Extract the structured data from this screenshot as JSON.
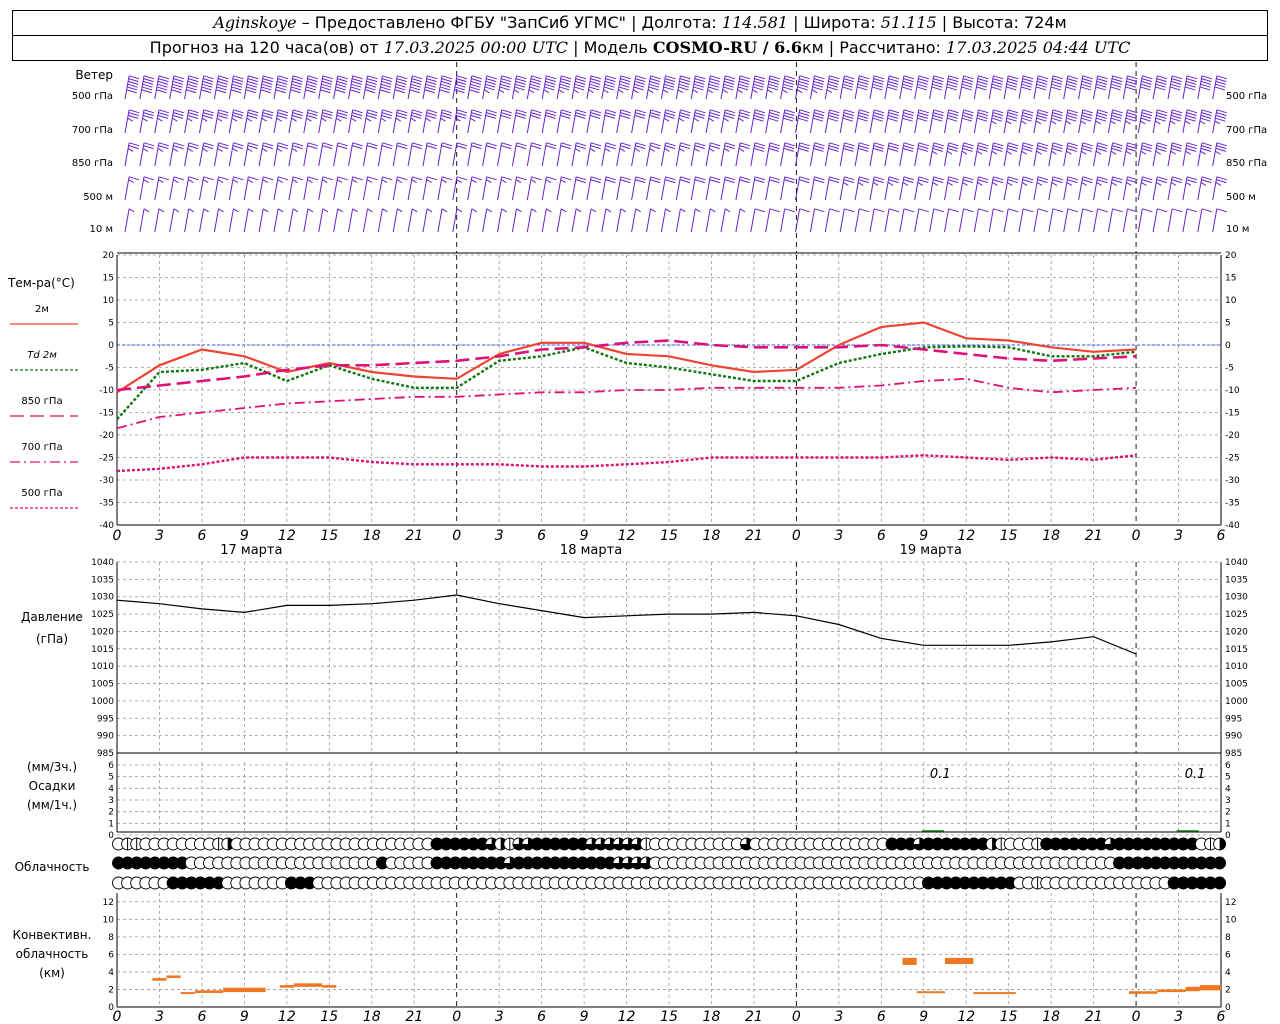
{
  "header": {
    "station": "Aginskoye",
    "provider": " – Предоставлено ФГБУ \"ЗапСиб УГМС\" | Долгота: ",
    "lon": "114.581",
    "lat_label": " | Широта: ",
    "lat": "51.115",
    "alt_label": " | Высота: ",
    "alt": "724м",
    "forecast_label": "Прогноз на 120 часа(ов) от ",
    "forecast_date": "17.03.2025 00:00 UTC",
    "model_label": "  | Модель ",
    "model": "COSMO-RU / 6.6",
    "model_unit": "км | Рассчитано: ",
    "calc_date": "17.03.2025 04:44 UTC"
  },
  "colors": {
    "t2m": "#ee4433",
    "td2m": "#117711",
    "t850": "#dd1177",
    "t700": "#dd1177",
    "t500": "#dd1177",
    "wind": "#6622cc",
    "pressure": "#000000",
    "conv": "#ee7722",
    "zero_line": "#3355ee"
  },
  "chart_data": [
    {
      "type": "wind_barbs",
      "title": "Ветер",
      "levels": [
        "500 гПа",
        "700 гПа",
        "850 гПа",
        "500 м",
        "10 м"
      ],
      "step_hours": 1,
      "speed_kt": {
        "500 гПа": [
          60,
          60,
          60,
          60,
          60,
          60,
          60,
          60,
          60,
          60,
          60,
          60,
          60,
          60,
          60,
          60,
          60,
          60,
          60,
          60,
          60,
          60,
          60,
          60,
          55,
          55,
          55,
          55,
          55,
          55,
          55,
          55,
          55,
          55,
          55,
          55,
          55,
          55,
          55,
          55,
          55,
          55,
          55,
          55,
          55,
          55,
          55,
          55,
          50,
          50,
          50,
          50,
          50,
          50,
          50,
          50,
          50,
          50,
          50,
          50,
          50,
          50,
          50,
          50,
          50,
          50,
          50,
          50,
          50,
          50,
          50,
          50,
          50,
          50
        ],
        "700 гПа": [
          35,
          35,
          35,
          35,
          35,
          35,
          35,
          35,
          35,
          35,
          35,
          35,
          35,
          35,
          35,
          35,
          35,
          35,
          35,
          35,
          35,
          35,
          35,
          35,
          30,
          30,
          30,
          30,
          30,
          30,
          30,
          30,
          30,
          30,
          30,
          30,
          35,
          35,
          35,
          35,
          35,
          35,
          40,
          40,
          40,
          40,
          40,
          40,
          40,
          40,
          40,
          40,
          40,
          40,
          40,
          40,
          40,
          40,
          45,
          45,
          45,
          45,
          45,
          45,
          45,
          45,
          45,
          45,
          45,
          45,
          45,
          45,
          45,
          45
        ],
        "850 гПа": [
          25,
          25,
          25,
          25,
          25,
          25,
          25,
          25,
          25,
          25,
          25,
          25,
          20,
          20,
          20,
          20,
          20,
          20,
          20,
          20,
          20,
          20,
          20,
          20,
          20,
          20,
          20,
          20,
          20,
          20,
          25,
          25,
          25,
          25,
          25,
          25,
          25,
          25,
          25,
          25,
          25,
          25,
          30,
          30,
          30,
          30,
          30,
          30,
          30,
          30,
          30,
          30,
          30,
          30,
          35,
          35,
          35,
          35,
          35,
          35,
          35,
          35,
          35,
          35,
          35,
          35,
          35,
          35,
          35,
          35,
          35,
          35,
          35,
          35
        ],
        "500 м": [
          15,
          15,
          15,
          15,
          15,
          15,
          15,
          15,
          15,
          15,
          15,
          15,
          15,
          15,
          15,
          15,
          15,
          15,
          15,
          15,
          15,
          15,
          15,
          15,
          15,
          15,
          15,
          15,
          15,
          15,
          20,
          20,
          20,
          20,
          20,
          20,
          20,
          20,
          20,
          20,
          20,
          20,
          20,
          20,
          20,
          20,
          20,
          20,
          25,
          25,
          25,
          25,
          25,
          25,
          25,
          25,
          25,
          25,
          25,
          25,
          25,
          25,
          25,
          25,
          25,
          25,
          25,
          25,
          25,
          25,
          25,
          25,
          25,
          25
        ],
        "10 м": [
          5,
          5,
          5,
          5,
          5,
          5,
          5,
          5,
          5,
          5,
          5,
          5,
          5,
          5,
          5,
          5,
          5,
          5,
          5,
          5,
          5,
          5,
          5,
          5,
          5,
          5,
          5,
          5,
          5,
          5,
          5,
          5,
          5,
          5,
          5,
          5,
          5,
          5,
          5,
          5,
          5,
          5,
          10,
          10,
          10,
          10,
          10,
          10,
          10,
          10,
          10,
          10,
          10,
          10,
          10,
          10,
          10,
          10,
          10,
          10,
          10,
          10,
          10,
          10,
          10,
          10,
          10,
          10,
          10,
          10,
          10,
          10,
          10,
          10
        ]
      }
    },
    {
      "type": "line",
      "title": "Тем-ра(°С)",
      "x_hours": [
        0,
        3,
        6,
        9,
        12,
        15,
        18,
        21,
        24,
        27,
        30,
        33,
        36,
        39,
        42,
        45,
        48,
        51,
        54,
        57,
        60,
        63,
        66,
        69,
        72
      ],
      "ylim": [
        -40,
        20
      ],
      "yticks": [
        -40,
        -35,
        -30,
        -25,
        -20,
        -15,
        -10,
        -5,
        0,
        5,
        10,
        15,
        20
      ],
      "series": [
        {
          "name": "2м",
          "values": [
            -10.5,
            -4.5,
            -1,
            -2.5,
            -6,
            -4,
            -6,
            -7,
            -7.5,
            -2,
            0.5,
            0.5,
            -2,
            -2.5,
            -4.5,
            -6,
            -5.5,
            0,
            4,
            5,
            1.5,
            1,
            -0.5,
            -1.5,
            -1
          ]
        },
        {
          "name": "Td 2м",
          "values": [
            -16.5,
            -6,
            -5.5,
            -4,
            -8,
            -4.5,
            -7.5,
            -9.5,
            -9.5,
            -3.5,
            -2.5,
            -0.5,
            -4,
            -5,
            -6.5,
            -8,
            -8,
            -4,
            -2,
            -0.5,
            -0.3,
            -0.5,
            -2.5,
            -2.5,
            -1.5
          ]
        },
        {
          "name": "850 гПа",
          "values": [
            -10,
            -9,
            -8,
            -7,
            -5.5,
            -4.5,
            -4.5,
            -4,
            -3.5,
            -2.5,
            -1,
            -0.5,
            0.5,
            1,
            0,
            -0.5,
            -0.5,
            -0.5,
            0,
            -1,
            -2,
            -3,
            -3.5,
            -3,
            -2.5
          ]
        },
        {
          "name": "700 гПа",
          "values": [
            -18.5,
            -16,
            -15,
            -14,
            -13,
            -12.5,
            -12,
            -11.5,
            -11.5,
            -11,
            -10.5,
            -10.5,
            -10,
            -10,
            -9.5,
            -9.5,
            -9.5,
            -9.5,
            -9,
            -8,
            -7.5,
            -9.5,
            -10.5,
            -10,
            -9.5
          ]
        },
        {
          "name": "500 гПа",
          "values": [
            -28,
            -27.5,
            -26.5,
            -25,
            -25,
            -25,
            -26,
            -26.5,
            -26.5,
            -26.5,
            -27,
            -27,
            -26.5,
            -26,
            -25,
            -25,
            -25,
            -25,
            -25,
            -24.5,
            -25,
            -25.5,
            -25,
            -25.5,
            -24.5
          ]
        }
      ],
      "xticks": [
        "0",
        "3",
        "6",
        "9",
        "12",
        "15",
        "18",
        "21",
        "0",
        "3",
        "6",
        "9",
        "12",
        "15",
        "18",
        "21",
        "0",
        "3",
        "6",
        "9",
        "12",
        "15",
        "18",
        "21",
        "0",
        "3",
        "6"
      ],
      "day_labels": [
        "17 марта",
        "18 марта",
        "19 марта"
      ]
    },
    {
      "type": "line",
      "title": "Давление",
      "ylabel": "(гПа)",
      "x_hours": [
        0,
        3,
        6,
        9,
        12,
        15,
        18,
        21,
        24,
        27,
        30,
        33,
        36,
        39,
        42,
        45,
        48,
        51,
        54,
        57,
        60,
        63,
        66,
        69,
        72
      ],
      "ylim": [
        985,
        1040
      ],
      "yticks": [
        985,
        990,
        995,
        1000,
        1005,
        1010,
        1015,
        1020,
        1025,
        1030,
        1035,
        1040
      ],
      "series": [
        {
          "name": "",
          "values": [
            1029,
            1028,
            1026.5,
            1025.5,
            1027.5,
            1027.5,
            1028,
            1029,
            1030.5,
            1028,
            1026,
            1024,
            1024.5,
            1025,
            1025,
            1025.5,
            1024.5,
            1022,
            1018,
            1016,
            1016,
            1016,
            1017,
            1018.5,
            1013.5
          ]
        }
      ]
    },
    {
      "type": "bar",
      "title": "Осадки",
      "ylabel": "(мм/3ч.) (мм/1ч.)",
      "ylim": [
        0,
        6
      ],
      "yticks": [
        0,
        1,
        2,
        3,
        4,
        5,
        6
      ],
      "annotations": [
        {
          "x_hour": 58,
          "text": "0.1"
        },
        {
          "x_hour": 76,
          "text": "0.1"
        }
      ]
    },
    {
      "type": "table",
      "title": "Облачность",
      "rows": 3,
      "step_hours": 1,
      "cover_upper": "011000000001200000000000000000000004444443213344444433333310000000000300000000000000044434444444210001444444434444444440122",
      "cover_middle": "444444440000000000000000000004000004444444434444444444433330000000000000000000000000000000000000000000000000004444444444444",
      "cover_lower": "000000444444000000044400000000000000000000000000000000000000000000000000000000000000000004444444444001000000000000004444444"
    },
    {
      "type": "bar",
      "title": "Конвективн. облачность (км)",
      "ylim": [
        0,
        13
      ],
      "yticks": [
        0,
        2,
        4,
        6,
        8,
        10,
        12
      ],
      "segments": [
        {
          "start": 2.5,
          "end": 3.5,
          "bottom": 3,
          "top": 3.3
        },
        {
          "start": 3.5,
          "end": 4.5,
          "bottom": 3.3,
          "top": 3.6
        },
        {
          "start": 4.5,
          "end": 5.5,
          "bottom": 1.5,
          "top": 1.7
        },
        {
          "start": 5.5,
          "end": 7.5,
          "bottom": 1.6,
          "top": 1.9
        },
        {
          "start": 7.5,
          "end": 10.5,
          "bottom": 1.7,
          "top": 2.2
        },
        {
          "start": 11.5,
          "end": 12.5,
          "bottom": 2.2,
          "top": 2.5
        },
        {
          "start": 12.5,
          "end": 14.5,
          "bottom": 2.3,
          "top": 2.7
        },
        {
          "start": 14.5,
          "end": 15.5,
          "bottom": 2.2,
          "top": 2.5
        },
        {
          "start": 55.5,
          "end": 56.5,
          "bottom": 4.8,
          "top": 5.6
        },
        {
          "start": 56.5,
          "end": 58.5,
          "bottom": 1.6,
          "top": 1.8
        },
        {
          "start": 58.5,
          "end": 60.5,
          "bottom": 4.9,
          "top": 5.6
        },
        {
          "start": 60.5,
          "end": 63.5,
          "bottom": 1.5,
          "top": 1.7
        },
        {
          "start": 71.5,
          "end": 73.5,
          "bottom": 1.5,
          "top": 1.8
        },
        {
          "start": 73.5,
          "end": 75.5,
          "bottom": 1.7,
          "top": 2.0
        },
        {
          "start": 75.5,
          "end": 76.5,
          "bottom": 1.8,
          "top": 2.3
        },
        {
          "start": 76.5,
          "end": 78,
          "bottom": 1.9,
          "top": 2.5
        }
      ]
    }
  ]
}
